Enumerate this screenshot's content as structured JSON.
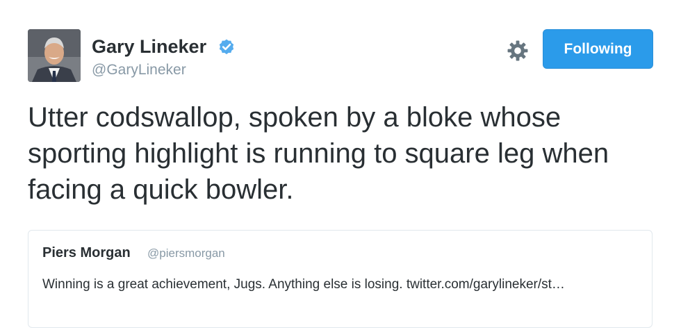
{
  "tweet": {
    "author": {
      "name": "Gary Lineker",
      "handle": "@GaryLineker",
      "verified": true
    },
    "follow_button_label": "Following",
    "text": "Utter codswallop, spoken by a bloke whose sporting highlight is running to square leg when facing a quick bowler.",
    "quoted_tweet": {
      "name": "Piers Morgan",
      "handle": "@piersmorgan",
      "text": "Winning is a great achievement, Jugs. Anything else is losing. twitter.com/garylineker/st…"
    }
  },
  "icons": {
    "verified": "verified-badge-icon",
    "settings": "gear-icon"
  },
  "colors": {
    "accent": "#2b9bea",
    "text": "#292f33",
    "muted": "#8899a6",
    "border": "#e1e8ed"
  }
}
